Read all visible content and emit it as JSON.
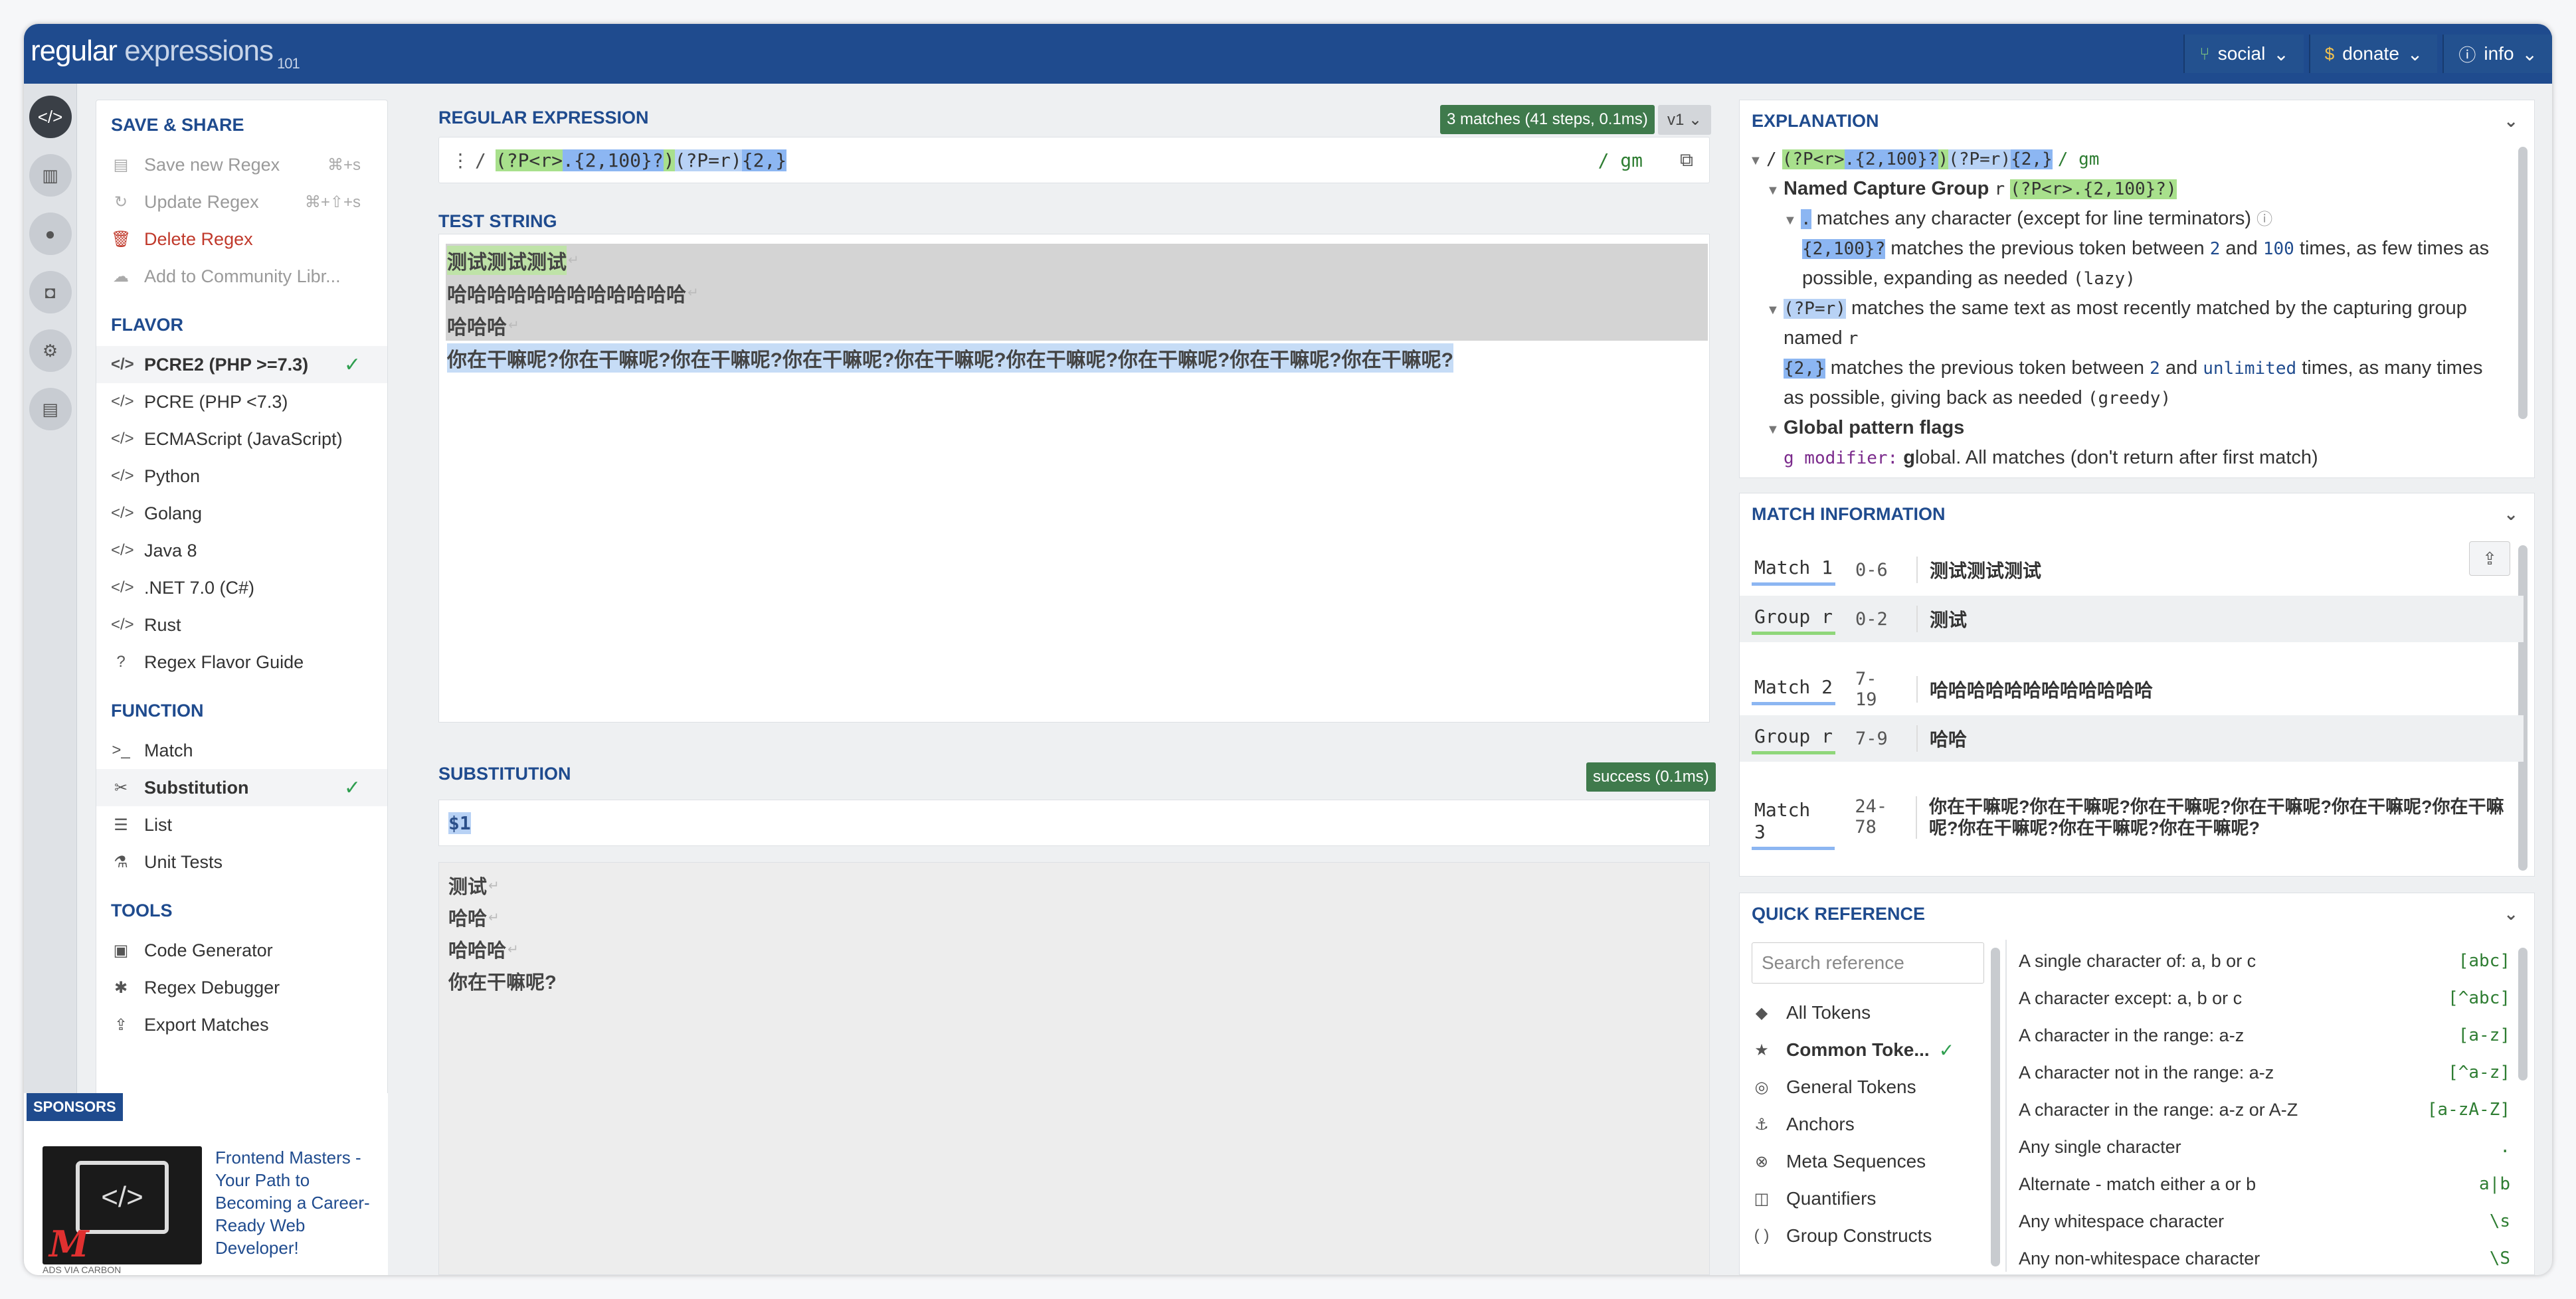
{
  "app": {
    "logo_part1": "regular",
    "logo_part2": " expressions",
    "logo_sub": "101"
  },
  "topnav": [
    {
      "label": "social",
      "icon": "branch-icon"
    },
    {
      "label": "donate",
      "icon": "dollar-icon"
    },
    {
      "label": "info",
      "icon": "info-icon"
    }
  ],
  "sidebar": {
    "save_share": {
      "title": "SAVE & SHARE",
      "items": [
        {
          "label": "Save new Regex",
          "shortcut": "⌘+s",
          "state": "disabled"
        },
        {
          "label": "Update Regex",
          "shortcut": "⌘+⇧+s",
          "state": "disabled"
        },
        {
          "label": "Delete Regex",
          "shortcut": "",
          "state": "danger"
        },
        {
          "label": "Add to Community Libr...",
          "shortcut": "",
          "state": "disabled"
        }
      ]
    },
    "flavor": {
      "title": "FLAVOR",
      "items": [
        {
          "label": "PCRE2 (PHP >=7.3)",
          "selected": true
        },
        {
          "label": "PCRE (PHP <7.3)"
        },
        {
          "label": "ECMAScript (JavaScript)"
        },
        {
          "label": "Python"
        },
        {
          "label": "Golang"
        },
        {
          "label": "Java 8"
        },
        {
          "label": ".NET 7.0 (C#)"
        },
        {
          "label": "Rust"
        },
        {
          "label": "Regex Flavor Guide"
        }
      ]
    },
    "function": {
      "title": "FUNCTION",
      "items": [
        {
          "label": "Match"
        },
        {
          "label": "Substitution",
          "selected": true
        },
        {
          "label": "List"
        },
        {
          "label": "Unit Tests"
        }
      ]
    },
    "tools": {
      "title": "TOOLS",
      "items": [
        {
          "label": "Code Generator"
        },
        {
          "label": "Regex Debugger"
        },
        {
          "label": "Export Matches"
        }
      ]
    }
  },
  "sponsor": {
    "tag": "SPONSORS",
    "text": "Frontend Masters - Your Path to Becoming a Career-Ready Web Developer!",
    "footer": "ADS VIA CARBON",
    "logo_text": "M"
  },
  "regex": {
    "label": "REGULAR EXPRESSION",
    "badge": "3 matches (41 steps, 0.1ms)",
    "version": "v1",
    "prefix": "/",
    "parts": [
      "(?P<r>",
      ".{2,100}?",
      ")",
      "(?P=r)",
      "{2,}"
    ],
    "flags": "/ gm"
  },
  "test_string": {
    "label": "TEST STRING",
    "lines": [
      "测试测试测试",
      "哈哈哈哈哈哈哈哈哈哈哈哈",
      "哈哈哈",
      "你在干嘛呢?你在干嘛呢?你在干嘛呢?你在干嘛呢?你在干嘛呢?你在干嘛呢?你在干嘛呢?你在干嘛呢?你在干嘛呢?"
    ]
  },
  "substitution": {
    "label": "SUBSTITUTION",
    "badge": "success (0.1ms)",
    "value": "$1",
    "output": [
      "测试",
      "哈哈",
      "哈哈哈",
      "你在干嘛呢?"
    ]
  },
  "explanation": {
    "title": "EXPLANATION",
    "summary_prefix": "/",
    "summary_parts": [
      "(?P<r>",
      ".{2,100}?",
      ")",
      "(?P=r)",
      "{2,}"
    ],
    "summary_flags": "/ gm",
    "ncg_title": "Named Capture Group",
    "ncg_name": "r",
    "ncg_code": "(?P<r>.{2,100}?)",
    "dot_code": ".",
    "dot_text": "matches any character (except for line terminators)",
    "q1_code": "{2,100}?",
    "q1_text_a": "matches the previous token between",
    "q1_n1": "2",
    "q1_and": "and",
    "q1_n2": "100",
    "q1_text_b": "times, as few times as",
    "q1_text_c": "possible, expanding as needed",
    "q1_lazy": "(lazy)",
    "br_code": "(?P=r)",
    "br_text": "matches the same text as most recently matched by the capturing group",
    "br_text2": "named",
    "br_name": "r",
    "q2_code": "{2,}",
    "q2_text_a": "matches the previous token between",
    "q2_n1": "2",
    "q2_and": "and",
    "q2_n2": "unlimited",
    "q2_text_b": "times, as many times",
    "q2_text_c": "as possible, giving back as needed",
    "q2_greedy": "(greedy)",
    "flags_title": "Global pattern flags",
    "g_mod": "g modifier:",
    "g_first": "g",
    "g_text": "lobal. All matches (don't return after first match)"
  },
  "match_info": {
    "title": "MATCH INFORMATION",
    "rows": [
      {
        "tag": "Match 1",
        "range": "0-6",
        "value": "测试测试测试",
        "kind": "match"
      },
      {
        "tag": "Group r",
        "range": "0-2",
        "value": "测试",
        "kind": "group"
      },
      {
        "tag": "Match 2",
        "range": "7-19",
        "value": "哈哈哈哈哈哈哈哈哈哈哈哈",
        "kind": "match"
      },
      {
        "tag": "Group r",
        "range": "7-9",
        "value": "哈哈",
        "kind": "group"
      },
      {
        "tag": "Match 3",
        "range": "24-78",
        "value": "你在干嘛呢?你在干嘛呢?你在干嘛呢?你在干嘛呢?你在干嘛呢?你在干嘛呢?你在干嘛呢?你在干嘛呢?你在干嘛呢?",
        "kind": "match"
      }
    ]
  },
  "quick_ref": {
    "title": "QUICK REFERENCE",
    "search_placeholder": "Search reference",
    "categories": [
      {
        "label": "All Tokens",
        "icon": "stack-icon"
      },
      {
        "label": "Common Toke...",
        "icon": "star-icon",
        "selected": true
      },
      {
        "label": "General Tokens",
        "icon": "target-icon"
      },
      {
        "label": "Anchors",
        "icon": "anchor-icon"
      },
      {
        "label": "Meta Sequences",
        "icon": "gear-icon"
      },
      {
        "label": "Quantifiers",
        "icon": "quantifier-icon"
      },
      {
        "label": "Group Constructs",
        "icon": "parens-icon"
      }
    ],
    "rows": [
      {
        "desc": "A single character of: a, b or c",
        "code": "[abc]"
      },
      {
        "desc": "A character except: a, b or c",
        "code": "[^abc]"
      },
      {
        "desc": "A character in the range: a-z",
        "code": "[a-z]"
      },
      {
        "desc": "A character not in the range: a-z",
        "code": "[^a-z]"
      },
      {
        "desc": "A character in the range: a-z or A-Z",
        "code": "[a-zA-Z]"
      },
      {
        "desc": "Any single character",
        "code": "."
      },
      {
        "desc": "Alternate - match either a or b",
        "code": "a|b"
      },
      {
        "desc": "Any whitespace character",
        "code": "\\s"
      },
      {
        "desc": "Any non-whitespace character",
        "code": "\\S"
      }
    ]
  },
  "colors": {
    "brand": "#1f4b8e",
    "match_green": "#a8e08c",
    "match_blue": "#8cb6f2",
    "success": "#3f7a4c"
  }
}
